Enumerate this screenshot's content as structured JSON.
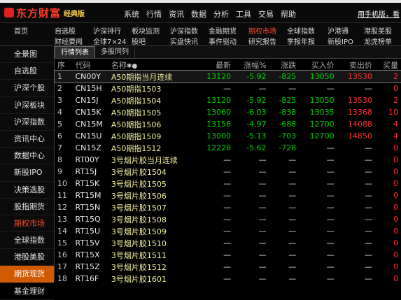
{
  "app": {
    "brand": "东方财富",
    "edition": "经典版",
    "phone_link": "用手机版，看"
  },
  "menu": [
    "系统",
    "行情",
    "资讯",
    "数据",
    "分析",
    "工具",
    "交易",
    "帮助"
  ],
  "nav": {
    "row1": [
      "首页",
      "自选股",
      "沪深排行",
      "板块监测",
      "沪深指数",
      "金融期货",
      "期权市场",
      "全球指数",
      "沪港通",
      "港股美股"
    ],
    "row2": [
      "财经要闻",
      "全球7×24",
      "股吧",
      "实盘快讯",
      "事件驱动",
      "研究报告",
      "季报年报",
      "新股IPO",
      "龙虎榜单"
    ],
    "active": "期权市场"
  },
  "sidebar": {
    "items": [
      "全景图",
      "自选股",
      "沪深个股",
      "沪深板块",
      "沪深指数",
      "资讯中心",
      "数据中心",
      "新股IPO",
      "决策选股",
      "股指期货",
      "期权市场",
      "全球指数",
      "港股美股",
      "期货现货",
      "基金理财"
    ],
    "red_item": "期权市场",
    "selected": "期货现货"
  },
  "tabs": [
    "行情列表",
    "多股同列"
  ],
  "table": {
    "headers": [
      "序",
      "代码",
      "名称",
      "最新",
      "涨幅%",
      "涨跌",
      "买入价",
      "卖出价",
      "买量"
    ],
    "rows": [
      {
        "seq": "1",
        "code": "CN00Y",
        "name": "A50期指当月连续",
        "last": "13120",
        "pct": "-5.92",
        "chg": "-825",
        "bid": "13050",
        "ask": "13530",
        "bidv": "2",
        "dir": "down"
      },
      {
        "seq": "2",
        "code": "CN15H",
        "name": "A50期指1503",
        "last": "—",
        "pct": "—",
        "chg": "—",
        "bid": "—",
        "ask": "—",
        "bidv": "0",
        "dir": "eq"
      },
      {
        "seq": "3",
        "code": "CN15J",
        "name": "A50期指1504",
        "last": "13120",
        "pct": "-5.92",
        "chg": "-825",
        "bid": "13050",
        "ask": "13530",
        "bidv": "2",
        "dir": "down"
      },
      {
        "seq": "4",
        "code": "CN15K",
        "name": "A50期指1505",
        "last": "13060",
        "pct": "-6.03",
        "chg": "-838",
        "bid": "13035",
        "ask": "13368",
        "bidv": "10",
        "dir": "down"
      },
      {
        "seq": "5",
        "code": "CN15M",
        "name": "A50期指1506",
        "last": "13158",
        "pct": "-4.97",
        "chg": "-688",
        "bid": "12700",
        "ask": "14088",
        "bidv": "4",
        "dir": "down"
      },
      {
        "seq": "6",
        "code": "CN15U",
        "name": "A50期指1509",
        "last": "13000",
        "pct": "-5.13",
        "chg": "-703",
        "bid": "12700",
        "ask": "14850",
        "bidv": "4",
        "dir": "down"
      },
      {
        "seq": "7",
        "code": "CN15Z",
        "name": "A50期指1512",
        "last": "12228",
        "pct": "-5.62",
        "chg": "-728",
        "bid": "—",
        "ask": "—",
        "bidv": "0",
        "dir": "down"
      },
      {
        "seq": "8",
        "code": "RT00Y",
        "name": "3号烟片胶当月连续",
        "last": "—",
        "pct": "—",
        "chg": "—",
        "bid": "—",
        "ask": "—",
        "bidv": "0",
        "dir": "eq"
      },
      {
        "seq": "9",
        "code": "RT15J",
        "name": "3号烟片胶1504",
        "last": "—",
        "pct": "—",
        "chg": "—",
        "bid": "—",
        "ask": "—",
        "bidv": "0",
        "dir": "eq"
      },
      {
        "seq": "10",
        "code": "RT15K",
        "name": "3号烟片胶1505",
        "last": "—",
        "pct": "—",
        "chg": "—",
        "bid": "—",
        "ask": "—",
        "bidv": "0",
        "dir": "eq"
      },
      {
        "seq": "11",
        "code": "RT15M",
        "name": "3号烟片胶1506",
        "last": "—",
        "pct": "—",
        "chg": "—",
        "bid": "—",
        "ask": "—",
        "bidv": "0",
        "dir": "eq"
      },
      {
        "seq": "12",
        "code": "RT15N",
        "name": "3号烟片胶1507",
        "last": "—",
        "pct": "—",
        "chg": "—",
        "bid": "—",
        "ask": "—",
        "bidv": "0",
        "dir": "eq"
      },
      {
        "seq": "13",
        "code": "RT15Q",
        "name": "3号烟片胶1508",
        "last": "—",
        "pct": "—",
        "chg": "—",
        "bid": "—",
        "ask": "—",
        "bidv": "0",
        "dir": "eq"
      },
      {
        "seq": "14",
        "code": "RT15U",
        "name": "3号烟片胶1509",
        "last": "—",
        "pct": "—",
        "chg": "—",
        "bid": "—",
        "ask": "—",
        "bidv": "0",
        "dir": "eq"
      },
      {
        "seq": "15",
        "code": "RT15V",
        "name": "3号烟片胶1510",
        "last": "—",
        "pct": "—",
        "chg": "—",
        "bid": "—",
        "ask": "—",
        "bidv": "0",
        "dir": "eq"
      },
      {
        "seq": "16",
        "code": "RT15X",
        "name": "3号烟片胶1511",
        "last": "—",
        "pct": "—",
        "chg": "—",
        "bid": "—",
        "ask": "—",
        "bidv": "0",
        "dir": "eq"
      },
      {
        "seq": "17",
        "code": "RT15Z",
        "name": "3号烟片胶1512",
        "last": "—",
        "pct": "—",
        "chg": "—",
        "bid": "—",
        "ask": "—",
        "bidv": "0",
        "dir": "eq"
      },
      {
        "seq": "18",
        "code": "RT16F",
        "name": "3号烟片胶1601",
        "last": "—",
        "pct": "—",
        "chg": "—",
        "bid": "—",
        "ask": "—",
        "bidv": "0",
        "dir": "eq"
      }
    ]
  },
  "colors": {
    "up": "#ff3030",
    "down": "#00d000",
    "accent": "#d15a00"
  }
}
